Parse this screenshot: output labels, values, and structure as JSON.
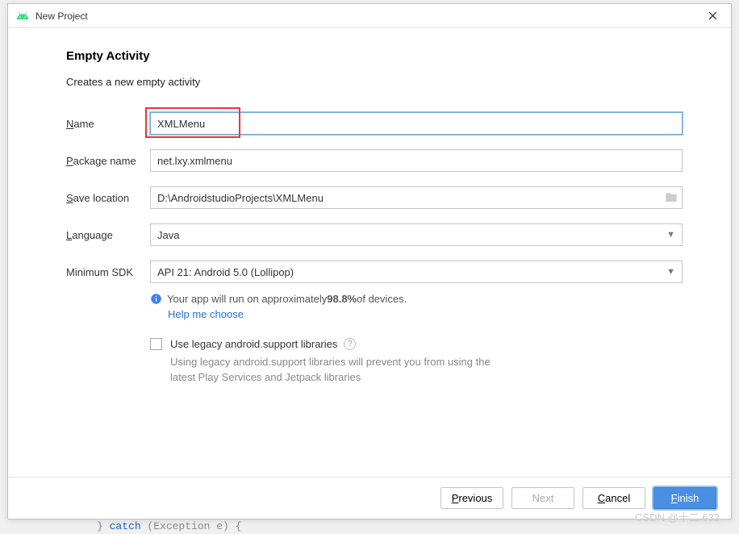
{
  "titlebar": {
    "title": "New Project"
  },
  "heading": "Empty Activity",
  "subheading": "Creates a new empty activity",
  "labels": {
    "name_pre": "N",
    "name_post": "ame",
    "package_pre": "P",
    "package_post": "ackage name",
    "save_pre": "S",
    "save_post": "ave location",
    "lang_pre": "L",
    "lang_post": "anguage",
    "sdk": "Minimum SDK"
  },
  "fields": {
    "name": "XMLMenu",
    "package": "net.lxy.xmlmenu",
    "save": "D:\\AndroidstudioProjects\\XMLMenu",
    "language": "Java",
    "minsdk": "API 21: Android 5.0 (Lollipop)"
  },
  "sdkinfo": {
    "text_pre": "Your app will run on approximately ",
    "percent": "98.8%",
    "text_post": " of devices.",
    "link": "Help me choose"
  },
  "legacy": {
    "label": "Use legacy android.support libraries",
    "desc": "Using legacy android.support libraries will prevent you from using the latest Play Services and Jetpack libraries"
  },
  "buttons": {
    "previous_pre": "P",
    "previous_post": "revious",
    "next": "Next",
    "cancel_pre": "C",
    "cancel_post": "ancel",
    "finish_pre": "F",
    "finish_post": "inish"
  },
  "watermark": "CSDN @十二.632",
  "bgcode": "} catch (Exception e) {"
}
